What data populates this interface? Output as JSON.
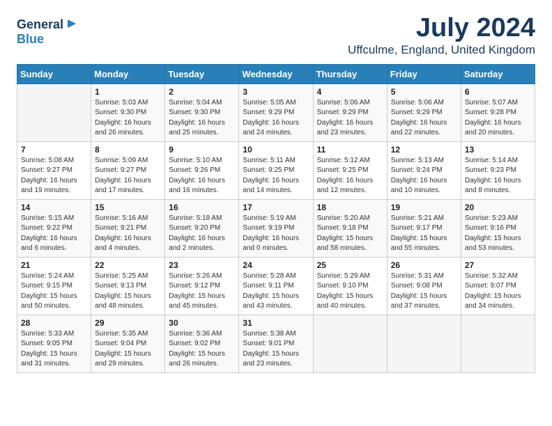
{
  "logo": {
    "line1": "General",
    "line2": "Blue"
  },
  "title": "July 2024",
  "location": "Uffculme, England, United Kingdom",
  "headers": [
    "Sunday",
    "Monday",
    "Tuesday",
    "Wednesday",
    "Thursday",
    "Friday",
    "Saturday"
  ],
  "weeks": [
    [
      {
        "day": "",
        "detail": ""
      },
      {
        "day": "1",
        "detail": "Sunrise: 5:03 AM\nSunset: 9:30 PM\nDaylight: 16 hours\nand 26 minutes."
      },
      {
        "day": "2",
        "detail": "Sunrise: 5:04 AM\nSunset: 9:30 PM\nDaylight: 16 hours\nand 25 minutes."
      },
      {
        "day": "3",
        "detail": "Sunrise: 5:05 AM\nSunset: 9:29 PM\nDaylight: 16 hours\nand 24 minutes."
      },
      {
        "day": "4",
        "detail": "Sunrise: 5:06 AM\nSunset: 9:29 PM\nDaylight: 16 hours\nand 23 minutes."
      },
      {
        "day": "5",
        "detail": "Sunrise: 5:06 AM\nSunset: 9:29 PM\nDaylight: 16 hours\nand 22 minutes."
      },
      {
        "day": "6",
        "detail": "Sunrise: 5:07 AM\nSunset: 9:28 PM\nDaylight: 16 hours\nand 20 minutes."
      }
    ],
    [
      {
        "day": "7",
        "detail": "Sunrise: 5:08 AM\nSunset: 9:27 PM\nDaylight: 16 hours\nand 19 minutes."
      },
      {
        "day": "8",
        "detail": "Sunrise: 5:09 AM\nSunset: 9:27 PM\nDaylight: 16 hours\nand 17 minutes."
      },
      {
        "day": "9",
        "detail": "Sunrise: 5:10 AM\nSunset: 9:26 PM\nDaylight: 16 hours\nand 16 minutes."
      },
      {
        "day": "10",
        "detail": "Sunrise: 5:11 AM\nSunset: 9:25 PM\nDaylight: 16 hours\nand 14 minutes."
      },
      {
        "day": "11",
        "detail": "Sunrise: 5:12 AM\nSunset: 9:25 PM\nDaylight: 16 hours\nand 12 minutes."
      },
      {
        "day": "12",
        "detail": "Sunrise: 5:13 AM\nSunset: 9:24 PM\nDaylight: 16 hours\nand 10 minutes."
      },
      {
        "day": "13",
        "detail": "Sunrise: 5:14 AM\nSunset: 9:23 PM\nDaylight: 16 hours\nand 8 minutes."
      }
    ],
    [
      {
        "day": "14",
        "detail": "Sunrise: 5:15 AM\nSunset: 9:22 PM\nDaylight: 16 hours\nand 6 minutes."
      },
      {
        "day": "15",
        "detail": "Sunrise: 5:16 AM\nSunset: 9:21 PM\nDaylight: 16 hours\nand 4 minutes."
      },
      {
        "day": "16",
        "detail": "Sunrise: 5:18 AM\nSunset: 9:20 PM\nDaylight: 16 hours\nand 2 minutes."
      },
      {
        "day": "17",
        "detail": "Sunrise: 5:19 AM\nSunset: 9:19 PM\nDaylight: 16 hours\nand 0 minutes."
      },
      {
        "day": "18",
        "detail": "Sunrise: 5:20 AM\nSunset: 9:18 PM\nDaylight: 15 hours\nand 58 minutes."
      },
      {
        "day": "19",
        "detail": "Sunrise: 5:21 AM\nSunset: 9:17 PM\nDaylight: 15 hours\nand 55 minutes."
      },
      {
        "day": "20",
        "detail": "Sunrise: 5:23 AM\nSunset: 9:16 PM\nDaylight: 15 hours\nand 53 minutes."
      }
    ],
    [
      {
        "day": "21",
        "detail": "Sunrise: 5:24 AM\nSunset: 9:15 PM\nDaylight: 15 hours\nand 50 minutes."
      },
      {
        "day": "22",
        "detail": "Sunrise: 5:25 AM\nSunset: 9:13 PM\nDaylight: 15 hours\nand 48 minutes."
      },
      {
        "day": "23",
        "detail": "Sunrise: 5:26 AM\nSunset: 9:12 PM\nDaylight: 15 hours\nand 45 minutes."
      },
      {
        "day": "24",
        "detail": "Sunrise: 5:28 AM\nSunset: 9:11 PM\nDaylight: 15 hours\nand 43 minutes."
      },
      {
        "day": "25",
        "detail": "Sunrise: 5:29 AM\nSunset: 9:10 PM\nDaylight: 15 hours\nand 40 minutes."
      },
      {
        "day": "26",
        "detail": "Sunrise: 5:31 AM\nSunset: 9:08 PM\nDaylight: 15 hours\nand 37 minutes."
      },
      {
        "day": "27",
        "detail": "Sunrise: 5:32 AM\nSunset: 9:07 PM\nDaylight: 15 hours\nand 34 minutes."
      }
    ],
    [
      {
        "day": "28",
        "detail": "Sunrise: 5:33 AM\nSunset: 9:05 PM\nDaylight: 15 hours\nand 31 minutes."
      },
      {
        "day": "29",
        "detail": "Sunrise: 5:35 AM\nSunset: 9:04 PM\nDaylight: 15 hours\nand 29 minutes."
      },
      {
        "day": "30",
        "detail": "Sunrise: 5:36 AM\nSunset: 9:02 PM\nDaylight: 15 hours\nand 26 minutes."
      },
      {
        "day": "31",
        "detail": "Sunrise: 5:38 AM\nSunset: 9:01 PM\nDaylight: 15 hours\nand 23 minutes."
      },
      {
        "day": "",
        "detail": ""
      },
      {
        "day": "",
        "detail": ""
      },
      {
        "day": "",
        "detail": ""
      }
    ]
  ]
}
